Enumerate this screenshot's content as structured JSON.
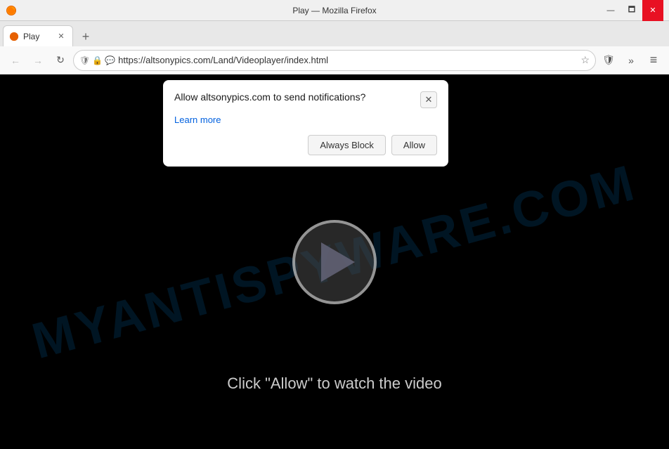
{
  "titlebar": {
    "title": "Play — Mozilla Firefox",
    "min_label": "—",
    "max_label": "🗖",
    "close_label": "✕"
  },
  "tab": {
    "title": "Play",
    "close_label": "✕"
  },
  "new_tab_btn": "+",
  "navbar": {
    "back": "←",
    "forward": "→",
    "reload": "↻",
    "shield_icon": "🛡",
    "lock_icon": "🔒",
    "notify_icon": "💬",
    "url": "https://altsonypics.com/Land/Videoplayer/index.html",
    "star_icon": "★",
    "shield_right": "🛡",
    "more_icon": "»",
    "menu_icon": "≡"
  },
  "popup": {
    "title": "Allow altsonypics.com to send notifications?",
    "learn_more": "Learn more",
    "always_block": "Always Block",
    "allow": "Allow",
    "close_icon": "✕"
  },
  "video": {
    "watermark": "MYANTISPYWARE.COM",
    "click_allow_text": "Click \"Allow\" to watch the video"
  },
  "colors": {
    "titlebar_bg": "#f0f0f0",
    "tab_bg": "#ffffff",
    "tabbar_bg": "#e8e8e8",
    "navbar_bg": "#f9f9f9",
    "video_bg": "#000000",
    "popup_bg": "#ffffff",
    "watermark": "rgba(0,60,100,0.35)",
    "accent_blue": "#0060df"
  }
}
